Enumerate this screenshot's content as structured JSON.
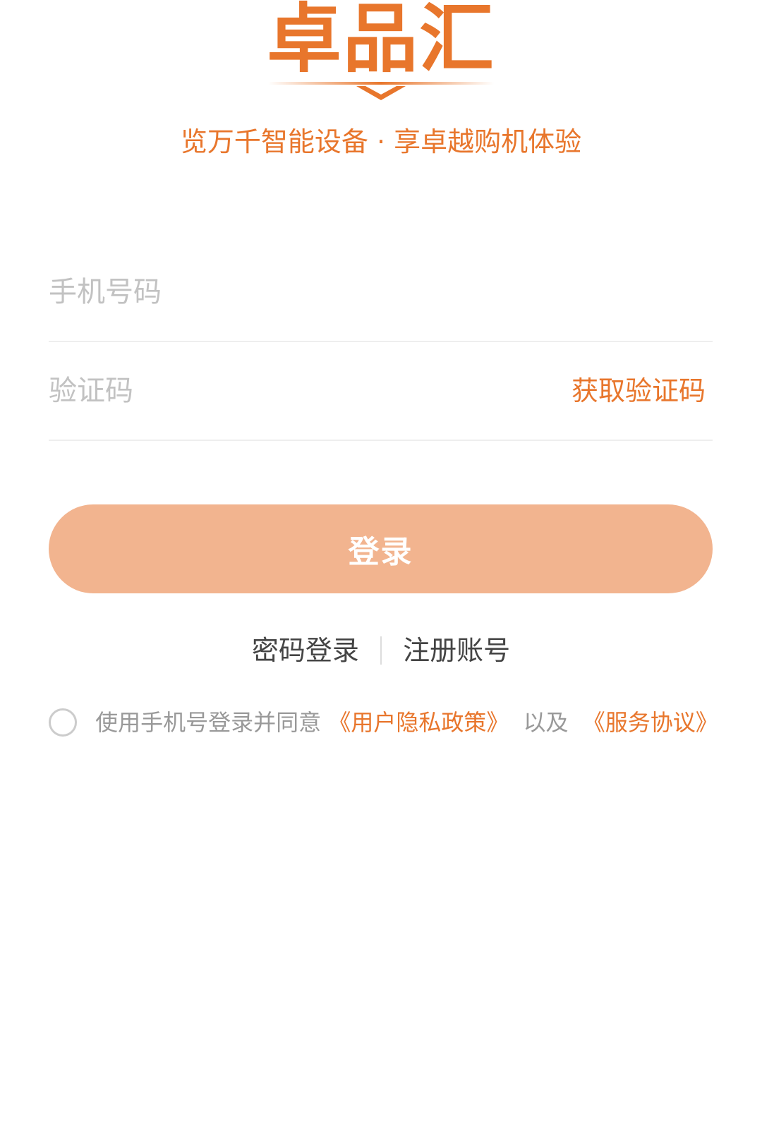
{
  "brand": {
    "logo_text": "卓品汇",
    "slogan": "览万千智能设备 · 享卓越购机体验",
    "accent_color": "#e8762c"
  },
  "form": {
    "phone_placeholder": "手机号码",
    "code_placeholder": "验证码",
    "get_code_label": "获取验证码"
  },
  "login_button": {
    "label": "登录",
    "color": "#f2b48f"
  },
  "alt_links": {
    "password_login": "密码登录",
    "register": "注册账号"
  },
  "agreement": {
    "prefix": "使用手机号登录并同意",
    "privacy_policy": "《用户隐私政策》",
    "and": "以及",
    "service_agreement": "《服务协议》"
  }
}
